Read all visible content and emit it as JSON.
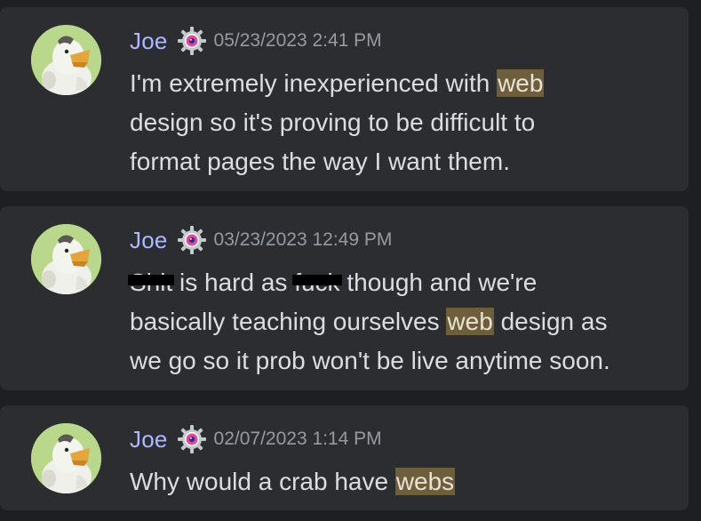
{
  "messages": [
    {
      "author": "Joe",
      "timestamp": "05/23/2023 2:41 PM",
      "lines": [
        {
          "before": "I'm extremely inexperienced with ",
          "highlight": "web",
          "after": ""
        },
        {
          "before": "design so it's proving to be difficult to",
          "highlight": "",
          "after": ""
        },
        {
          "before": "format pages the way I want them.",
          "highlight": "",
          "after": ""
        }
      ]
    },
    {
      "author": "Joe",
      "timestamp": "03/23/2023 12:49 PM",
      "lines": [
        {
          "redact1": "Shit",
          "mid1": " is hard as ",
          "redact2": "fuck",
          "mid2": " though and we're"
        },
        {
          "before": "basically teaching ourselves ",
          "highlight": "web",
          "after": " design as"
        },
        {
          "before": "we go so it prob won't be live anytime soon.",
          "highlight": "",
          "after": ""
        }
      ]
    },
    {
      "author": "Joe",
      "timestamp": "02/07/2023 1:14 PM",
      "lines": [
        {
          "before": "Why would a crab have ",
          "highlight": "webs",
          "after": ""
        }
      ]
    }
  ],
  "colors": {
    "background": "#1e1f22",
    "card": "#2b2d31",
    "author": "#aeb9ff",
    "timestamp": "#949ba4",
    "text": "#dbdee1",
    "highlight": "#6e5e3b"
  },
  "icons": {
    "avatar": "avatar-image",
    "badge": "gear-badge-icon"
  }
}
